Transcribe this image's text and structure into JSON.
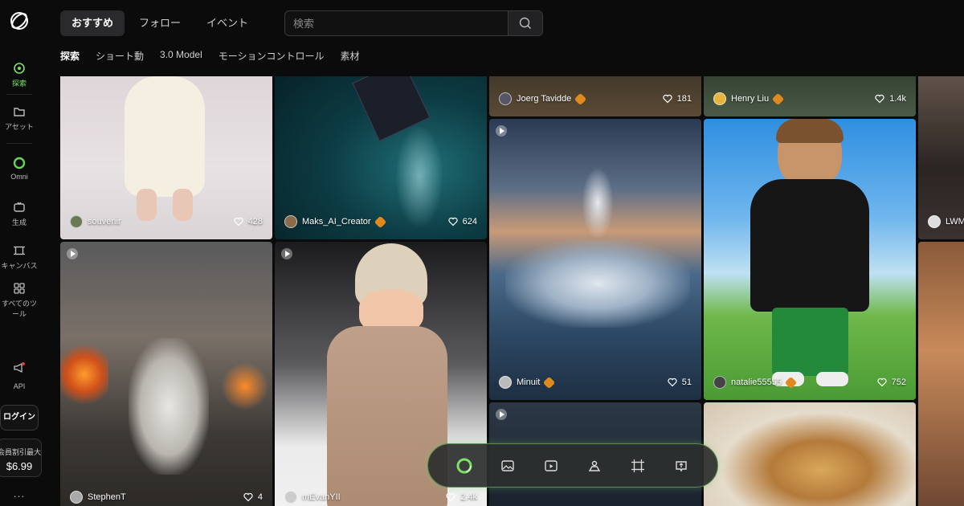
{
  "sidebar": {
    "items": [
      {
        "label": "探索",
        "icon": "explore-icon",
        "active": true
      },
      {
        "label": "アセット",
        "icon": "folder-icon"
      },
      {
        "label": "Omni",
        "icon": "omni-ring-icon"
      },
      {
        "label": "生成",
        "icon": "generate-icon"
      },
      {
        "label": "キャンバス",
        "icon": "canvas-icon"
      },
      {
        "label": "すべてのツール",
        "icon": "grid-icon"
      },
      {
        "label": "API",
        "icon": "megaphone-icon"
      }
    ],
    "login_label": "ログイン",
    "promo_text": "会員割引最大",
    "promo_price": "$6.99",
    "more_label": "..."
  },
  "header": {
    "tabs": [
      {
        "label": "おすすめ",
        "active": true
      },
      {
        "label": "フォロー"
      },
      {
        "label": "イベント"
      }
    ],
    "search_placeholder": "検索"
  },
  "subnav": [
    {
      "label": "探索",
      "active": true
    },
    {
      "label": "ショート動"
    },
    {
      "label": "3.0 Model"
    },
    {
      "label": "モーションコントロール"
    },
    {
      "label": "素材"
    }
  ],
  "cards": [
    {
      "user": "souvenir",
      "likes": "428",
      "badge": false
    },
    {
      "user": "Maks_AI_Creator",
      "likes": "624",
      "badge": true
    },
    {
      "user": "Joerg Tavidde",
      "likes": "181",
      "badge": true
    },
    {
      "user": "Henry Liu",
      "likes": "1.4k",
      "badge": true
    },
    {
      "user": "LWM",
      "likes": "",
      "badge": false
    },
    {
      "user": "Minuit",
      "likes": "51",
      "badge": true
    },
    {
      "user": "natalie55555",
      "likes": "752",
      "badge": true
    },
    {
      "user": "StephenT",
      "likes": "4",
      "badge": false
    },
    {
      "user": "mEvanYII",
      "likes": "2.4k",
      "badge": false
    },
    {
      "user": "",
      "likes": "",
      "badge": false
    },
    {
      "user": "",
      "likes": "",
      "badge": false
    },
    {
      "user": "",
      "likes": "",
      "badge": false
    }
  ],
  "dock": {
    "items": [
      "omni-ring-icon",
      "image-icon",
      "video-icon",
      "character-icon",
      "canvas-icon",
      "upload-icon"
    ]
  },
  "colors": {
    "accent": "#7ee06b",
    "badge": "#e08a1e",
    "background": "#0b0b0c"
  }
}
